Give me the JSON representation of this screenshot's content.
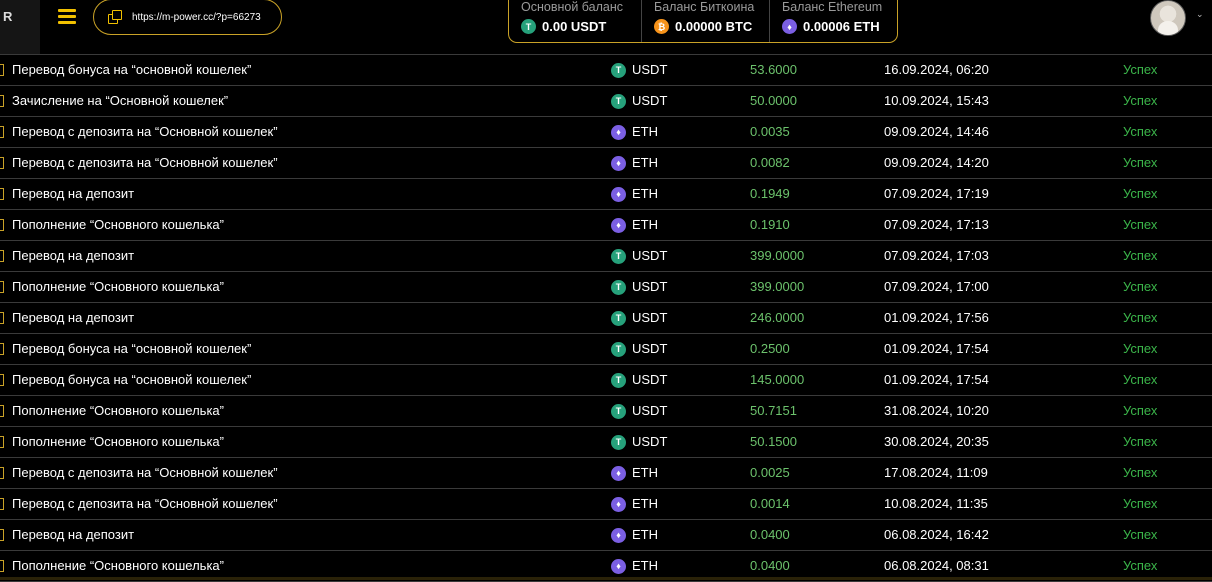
{
  "header": {
    "logo_fragment": "R",
    "ref_link": "https://m-power.cc/?p=66273",
    "balances": [
      {
        "title": "Основной баланс",
        "value": "0.00 USDT",
        "coin": "usdt-icon",
        "glyph": "T"
      },
      {
        "title": "Баланс Биткоина",
        "value": "0.00000 BTC",
        "coin": "btc-icon",
        "glyph": "₿"
      },
      {
        "title": "Баланс Ethereum",
        "value": "0.00006 ETH",
        "coin": "eth-icon",
        "glyph": "♦"
      }
    ],
    "chevron": "⌄"
  },
  "transactions": [
    {
      "desc": "Перевод бонуса на “основной кошелек”",
      "currency": "USDT",
      "amount": "53.6000",
      "date": "16.09.2024, 06:20",
      "status": "Успех"
    },
    {
      "desc": "Зачисление на “Основной кошелек”",
      "currency": "USDT",
      "amount": "50.0000",
      "date": "10.09.2024, 15:43",
      "status": "Успех"
    },
    {
      "desc": "Перевод с депозита на “Основной кошелек”",
      "currency": "ETH",
      "amount": "0.0035",
      "date": "09.09.2024, 14:46",
      "status": "Успех"
    },
    {
      "desc": "Перевод с депозита на “Основной кошелек”",
      "currency": "ETH",
      "amount": "0.0082",
      "date": "09.09.2024, 14:20",
      "status": "Успех"
    },
    {
      "desc": "Перевод на депозит",
      "currency": "ETH",
      "amount": "0.1949",
      "date": "07.09.2024, 17:19",
      "status": "Успех"
    },
    {
      "desc": "Пополнение “Основного кошелька”",
      "currency": "ETH",
      "amount": "0.1910",
      "date": "07.09.2024, 17:13",
      "status": "Успех"
    },
    {
      "desc": "Перевод на депозит",
      "currency": "USDT",
      "amount": "399.0000",
      "date": "07.09.2024, 17:03",
      "status": "Успех"
    },
    {
      "desc": "Пополнение “Основного кошелька”",
      "currency": "USDT",
      "amount": "399.0000",
      "date": "07.09.2024, 17:00",
      "status": "Успех"
    },
    {
      "desc": "Перевод на депозит",
      "currency": "USDT",
      "amount": "246.0000",
      "date": "01.09.2024, 17:56",
      "status": "Успех"
    },
    {
      "desc": "Перевод бонуса на “основной кошелек”",
      "currency": "USDT",
      "amount": "0.2500",
      "date": "01.09.2024, 17:54",
      "status": "Успех"
    },
    {
      "desc": "Перевод бонуса на “основной кошелек”",
      "currency": "USDT",
      "amount": "145.0000",
      "date": "01.09.2024, 17:54",
      "status": "Успех"
    },
    {
      "desc": "Пополнение “Основного кошелька”",
      "currency": "USDT",
      "amount": "50.7151",
      "date": "31.08.2024, 10:20",
      "status": "Успех"
    },
    {
      "desc": "Пополнение “Основного кошелька”",
      "currency": "USDT",
      "amount": "50.1500",
      "date": "30.08.2024, 20:35",
      "status": "Успех"
    },
    {
      "desc": "Перевод с депозита на “Основной кошелек”",
      "currency": "ETH",
      "amount": "0.0025",
      "date": "17.08.2024, 11:09",
      "status": "Успех"
    },
    {
      "desc": "Перевод с депозита на “Основной кошелек”",
      "currency": "ETH",
      "amount": "0.0014",
      "date": "10.08.2024, 11:35",
      "status": "Успех"
    },
    {
      "desc": "Перевод на депозит",
      "currency": "ETH",
      "amount": "0.0400",
      "date": "06.08.2024, 16:42",
      "status": "Успех"
    },
    {
      "desc": "Пополнение “Основного кошелька”",
      "currency": "ETH",
      "amount": "0.0400",
      "date": "06.08.2024, 08:31",
      "status": "Успех"
    }
  ],
  "colors": {
    "accent": "#f2c100",
    "border_gold": "#c9a227",
    "amount_green": "#6cc26c",
    "status_green": "#3bb54a",
    "usdt": "#26a17b",
    "btc": "#f7931a",
    "eth": "#7b5fe3"
  }
}
